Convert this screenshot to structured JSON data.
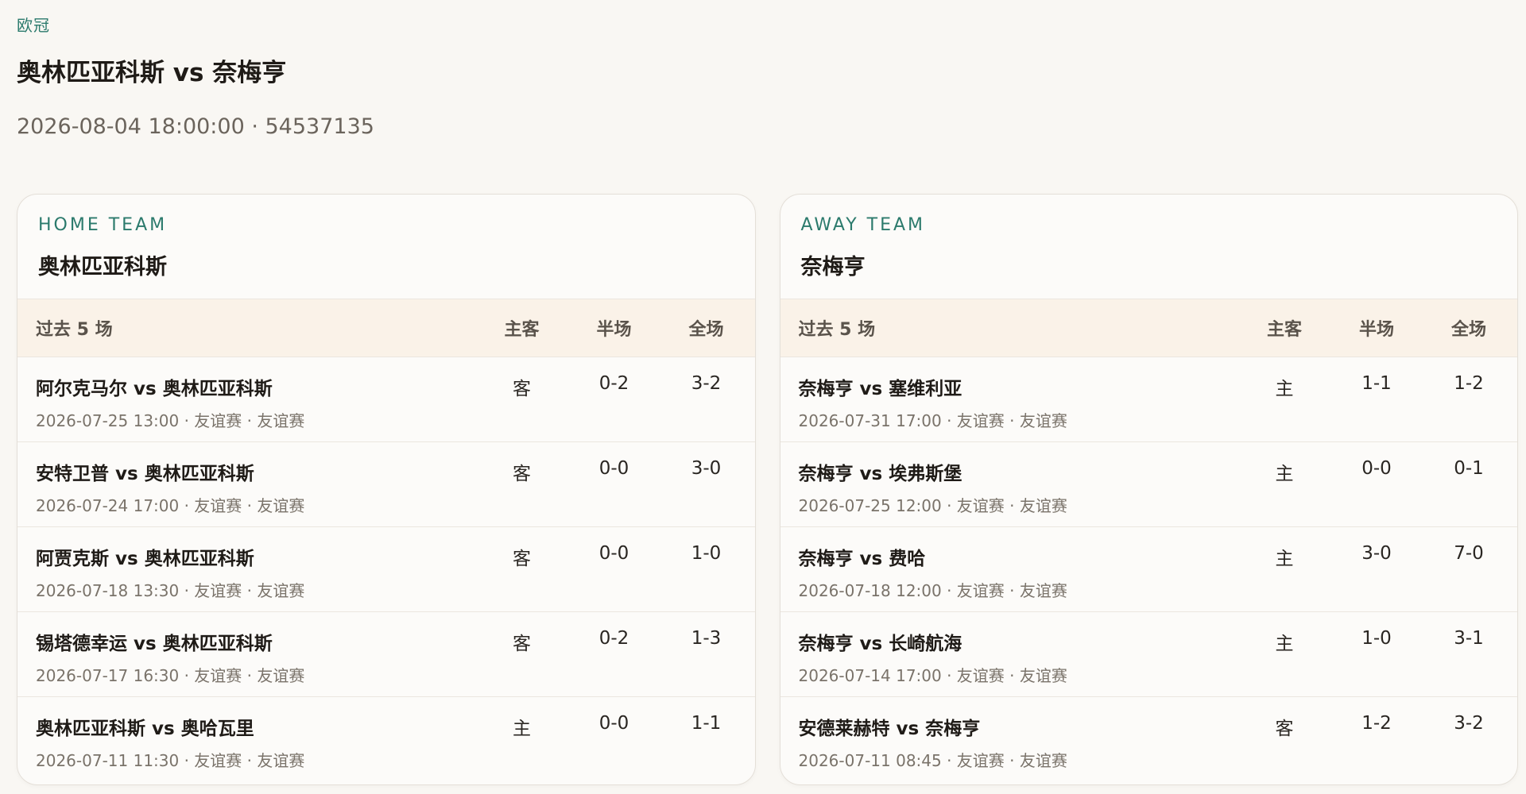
{
  "header": {
    "league": "欧冠",
    "title": "奥林匹亚科斯 vs 奈梅亨",
    "meta": "2026-08-04 18:00:00 · 54537135"
  },
  "columns": {
    "past": "过去 5 场",
    "venue": "主客",
    "half": "半场",
    "full": "全场"
  },
  "home": {
    "kicker": "HOME TEAM",
    "team": "奥林匹亚科斯",
    "matches": [
      {
        "title": "阿尔克马尔 vs 奥林匹亚科斯",
        "sub": "2026-07-25 13:00 · 友谊赛 · 友谊赛",
        "venue": "客",
        "half": "0-2",
        "full": "3-2"
      },
      {
        "title": "安特卫普 vs 奥林匹亚科斯",
        "sub": "2026-07-24 17:00 · 友谊赛 · 友谊赛",
        "venue": "客",
        "half": "0-0",
        "full": "3-0"
      },
      {
        "title": "阿贾克斯 vs 奥林匹亚科斯",
        "sub": "2026-07-18 13:30 · 友谊赛 · 友谊赛",
        "venue": "客",
        "half": "0-0",
        "full": "1-0"
      },
      {
        "title": "锡塔德幸运 vs 奥林匹亚科斯",
        "sub": "2026-07-17 16:30 · 友谊赛 · 友谊赛",
        "venue": "客",
        "half": "0-2",
        "full": "1-3"
      },
      {
        "title": "奥林匹亚科斯 vs 奥哈瓦里",
        "sub": "2026-07-11 11:30 · 友谊赛 · 友谊赛",
        "venue": "主",
        "half": "0-0",
        "full": "1-1"
      }
    ]
  },
  "away": {
    "kicker": "AWAY TEAM",
    "team": "奈梅亨",
    "matches": [
      {
        "title": "奈梅亨 vs 塞维利亚",
        "sub": "2026-07-31 17:00 · 友谊赛 · 友谊赛",
        "venue": "主",
        "half": "1-1",
        "full": "1-2"
      },
      {
        "title": "奈梅亨 vs 埃弗斯堡",
        "sub": "2026-07-25 12:00 · 友谊赛 · 友谊赛",
        "venue": "主",
        "half": "0-0",
        "full": "0-1"
      },
      {
        "title": "奈梅亨 vs 费哈",
        "sub": "2026-07-18 12:00 · 友谊赛 · 友谊赛",
        "venue": "主",
        "half": "3-0",
        "full": "7-0"
      },
      {
        "title": "奈梅亨 vs 长崎航海",
        "sub": "2026-07-14 17:00 · 友谊赛 · 友谊赛",
        "venue": "主",
        "half": "1-0",
        "full": "3-1"
      },
      {
        "title": "安德莱赫特 vs 奈梅亨",
        "sub": "2026-07-11 08:45 · 友谊赛 · 友谊赛",
        "venue": "客",
        "half": "1-2",
        "full": "3-2"
      }
    ]
  }
}
